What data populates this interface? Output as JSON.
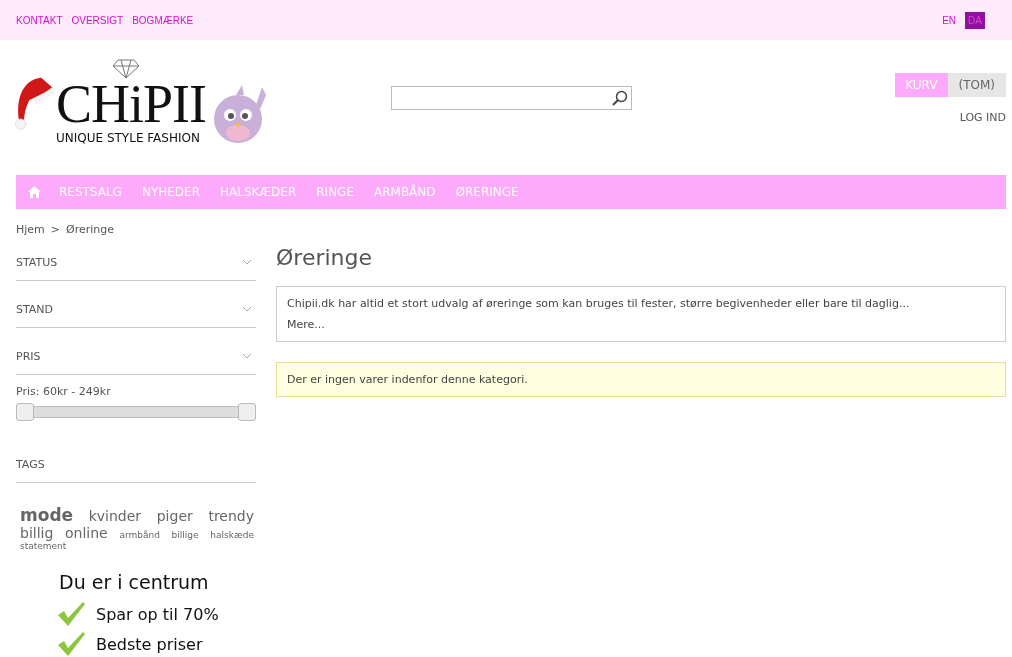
{
  "top_links": [
    "KONTAKT",
    "OVERSIGT",
    "BOGMÆRKE"
  ],
  "languages": [
    {
      "label": "EN",
      "selected": false
    },
    {
      "label": "DA",
      "selected": true
    }
  ],
  "logo": {
    "name": "CHiPII",
    "tagline": "UNIQUE STYLE FASHION"
  },
  "cart": {
    "label": "KURV",
    "status": "(TOM)"
  },
  "login": "LOG IND",
  "nav": [
    "RESTSALG",
    "NYHEDER",
    "HALSKÆDER",
    "RINGE",
    "ARMBÅND",
    "ØRERINGE"
  ],
  "breadcrumb": {
    "home": "Hjem",
    "separator": ">",
    "current": "Øreringe"
  },
  "filters": [
    {
      "label": "STATUS"
    },
    {
      "label": "STAND"
    },
    {
      "label": "PRIS"
    }
  ],
  "price": {
    "label": "Pris: 60kr - 249kr",
    "thumbs": [
      {
        "level": 0
      },
      {
        "level": 1
      }
    ]
  },
  "tags": {
    "title": "TAGS",
    "items": [
      {
        "label": "mode",
        "kind": "featured"
      },
      {
        "label": "kvinder",
        "kind": "popular"
      },
      {
        "label": "piger",
        "kind": "popular"
      },
      {
        "label": "trendy",
        "kind": "popular"
      },
      {
        "label": "billig",
        "kind": "popular"
      },
      {
        "label": "online",
        "kind": "popular"
      },
      {
        "label": "armbånd",
        "kind": "minor"
      },
      {
        "label": "billige",
        "kind": "minor"
      },
      {
        "label": "halskæde",
        "kind": "minor"
      },
      {
        "label": "statement",
        "kind": "minor"
      }
    ]
  },
  "promo": {
    "title": "Du er i centrum",
    "points": [
      "Spar op til 70%",
      "Bedste priser"
    ]
  },
  "page_title": "Øreringe",
  "description": "Chipii.dk har altid et stort udvalg af øreringe som kan bruges til fester, større begivenheder eller bare til daglig...",
  "more_link": "Mere...",
  "notice": "Der er ingen varer indenfor denne kategori."
}
